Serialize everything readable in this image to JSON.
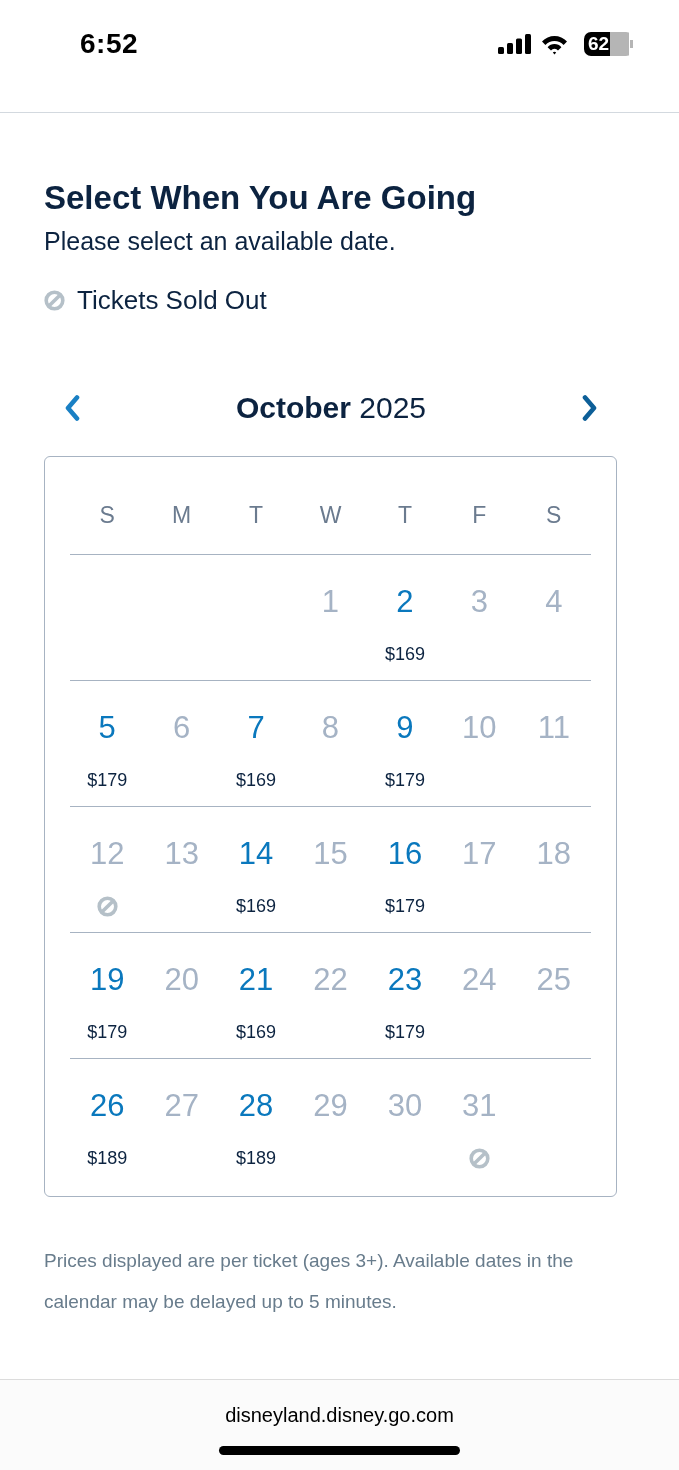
{
  "status_bar": {
    "time": "6:52",
    "battery": "62"
  },
  "header": {
    "title": "Select When You Are Going",
    "subtitle": "Please select an available date."
  },
  "legend": {
    "label": "Tickets Sold Out"
  },
  "calendar": {
    "month_title": "**October** 2025",
    "weekdays": [
      "S",
      "M",
      "T",
      "W",
      "T",
      "F",
      "S"
    ],
    "weeks": [
      [
        {
          "day": "1",
          "available": false,
          "sold_out": false
        },
        {
          "day": "2",
          "available": true,
          "sold_out": false,
          "price": "$169"
        },
        {
          "day": "3",
          "available": false,
          "sold_out": false
        },
        {
          "day": "4",
          "available": false,
          "sold_out": false
        }
      ],
      [
        {
          "day": "5",
          "available": true,
          "sold_out": false,
          "price": "$179"
        },
        {
          "day": "6",
          "available": false,
          "sold_out": false
        },
        {
          "day": "7",
          "available": true,
          "sold_out": false,
          "price": "$169"
        },
        {
          "day": "8",
          "available": false,
          "sold_out": false
        },
        {
          "day": "9",
          "available": true,
          "sold_out": false,
          "price": "$179"
        },
        {
          "day": "10",
          "available": false,
          "sold_out": false
        },
        {
          "day": "11",
          "available": false,
          "sold_out": false
        }
      ],
      [
        {
          "day": "12",
          "available": false,
          "sold_out": true
        },
        {
          "day": "13",
          "available": false,
          "sold_out": false
        },
        {
          "day": "14",
          "available": true,
          "sold_out": false,
          "price": "$169"
        },
        {
          "day": "15",
          "available": false,
          "sold_out": false
        },
        {
          "day": "16",
          "available": true,
          "sold_out": false,
          "price": "$179"
        },
        {
          "day": "17",
          "available": false,
          "sold_out": false
        },
        {
          "day": "18",
          "available": false,
          "sold_out": false
        }
      ],
      [
        {
          "day": "19",
          "available": true,
          "sold_out": false,
          "price": "$179"
        },
        {
          "day": "20",
          "available": false,
          "sold_out": false
        },
        {
          "day": "21",
          "available": true,
          "sold_out": false,
          "price": "$169"
        },
        {
          "day": "22",
          "available": false,
          "sold_out": false
        },
        {
          "day": "23",
          "available": true,
          "sold_out": false,
          "price": "$179"
        },
        {
          "day": "24",
          "available": false,
          "sold_out": false
        },
        {
          "day": "25",
          "available": false,
          "sold_out": false
        }
      ],
      [
        {
          "day": "26",
          "available": true,
          "sold_out": false,
          "price": "$189"
        },
        {
          "day": "27",
          "available": false,
          "sold_out": false
        },
        {
          "day": "28",
          "available": true,
          "sold_out": false,
          "price": "$189"
        },
        {
          "day": "29",
          "available": false,
          "sold_out": false
        },
        {
          "day": "30",
          "available": false,
          "sold_out": false
        },
        {
          "day": "31",
          "available": false,
          "sold_out": true
        }
      ]
    ]
  },
  "footnote": "Prices displayed are per ticket (ages 3+). Available dates in the calendar may be delayed up to 5 minutes.",
  "browser_bar": {
    "url": "disneyland.disney.go.com"
  }
}
